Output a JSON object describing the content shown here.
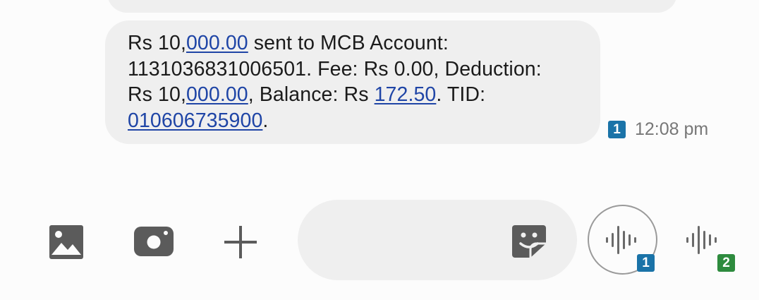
{
  "message": {
    "line1": {
      "t1": "Rs 10,",
      "l1": "000.00",
      "t2": " sent to MCB Account:"
    },
    "line2": "1131036831006501. Fee: Rs 0.00, Deduction:",
    "line3": {
      "t1": "Rs 10,",
      "l1": "000.00",
      "t2": ", Balance: Rs ",
      "l2": "172.50",
      "t3": ". TID:"
    },
    "line4": {
      "l1": "010606735900",
      "t1": "."
    },
    "sim": "1",
    "time": "12:08 pm"
  },
  "composer": {
    "gallery_icon": "image-icon",
    "camera_icon": "camera-icon",
    "add_icon": "plus-icon",
    "sticker_icon": "sticker-icon",
    "voice_sim1": "1",
    "voice_sim2": "2"
  },
  "colors": {
    "link": "#1f45a6",
    "sim1": "#1a73a8",
    "sim2": "#2e8b3e",
    "bubble": "#efefef"
  }
}
